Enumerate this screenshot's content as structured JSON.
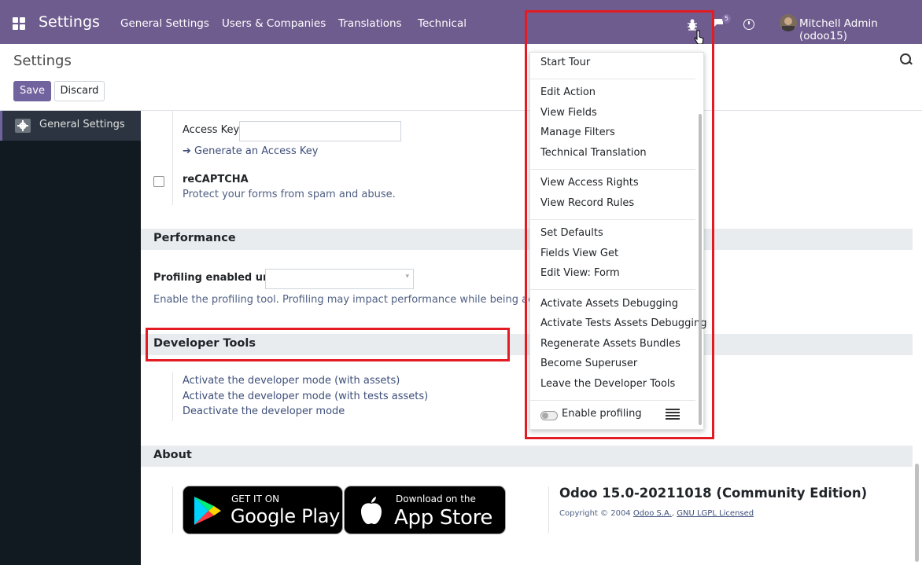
{
  "navbar": {
    "brand": "Settings",
    "menus": [
      "General Settings",
      "Users & Companies",
      "Translations",
      "Technical"
    ],
    "chat_badge": "5",
    "user": "Mitchell Admin (odoo15)"
  },
  "control_panel": {
    "title": "Settings",
    "save_label": "Save",
    "discard_label": "Discard"
  },
  "sidebar": {
    "items": [
      {
        "label": "General Settings"
      }
    ]
  },
  "recaptcha": {
    "access_key_label": "Access Key",
    "access_key_value": "",
    "generate_link": "Generate an Access Key",
    "title": "reCAPTCHA",
    "description": "Protect your forms from spam and abuse."
  },
  "performance": {
    "section_title": "Performance",
    "profiling_label": "Profiling enabled until",
    "profiling_value": "",
    "description": "Enable the profiling tool. Profiling may impact performance while being active."
  },
  "developer_tools": {
    "section_title": "Developer Tools",
    "links": [
      "Activate the developer mode (with assets)",
      "Activate the developer mode (with tests assets)",
      "Deactivate the developer mode"
    ]
  },
  "about": {
    "section_title": "About",
    "google_play_small": "GET IT ON",
    "google_play_big": "Google Play",
    "app_store_small": "Download on the",
    "app_store_big": "App Store",
    "version": "Odoo 15.0-20211018 (Community Edition)",
    "copyright_prefix": "Copyright © 2004",
    "company_link": "Odoo S.A.",
    "license_link": "GNU LGPL Licensed"
  },
  "debug_menu": {
    "items": [
      "Start Tour",
      "Edit Action",
      "View Fields",
      "Manage Filters",
      "Technical Translation",
      "View Access Rights",
      "View Record Rules",
      "Set Defaults",
      "Fields View Get",
      "Edit View: Form",
      "Activate Assets Debugging",
      "Activate Tests Assets Debugging",
      "Regenerate Assets Bundles",
      "Become Superuser",
      "Leave the Developer Tools"
    ],
    "profiling_label": "Enable profiling",
    "profiling_enabled": false
  },
  "colors": {
    "navbar": "#6e5c8e",
    "primary": "#71639e",
    "sidebar": "#111921",
    "highlight": "#e31b23"
  }
}
